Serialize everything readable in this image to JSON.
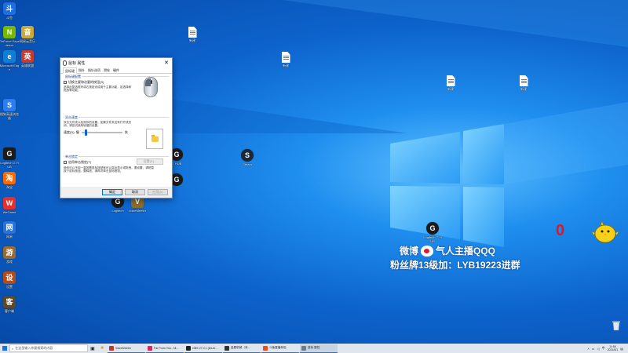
{
  "desktop": {
    "icons_left": [
      {
        "name": "doudian",
        "label": "斗鱼",
        "color": "#1f6fe0",
        "glyph": "斗"
      },
      {
        "name": "nvidia",
        "label": "GeForce Experience",
        "color": "#76b900",
        "glyph": "N"
      },
      {
        "name": "edge",
        "label": "Microsoft Edge",
        "color": "#0f7fd6",
        "glyph": "e"
      },
      {
        "name": "sogou",
        "label": "搜狗高速浏览器",
        "color": "#2d7cf0",
        "glyph": "S"
      },
      {
        "name": "logitech",
        "label": "Logitech G HUB",
        "color": "#1b1b1b",
        "glyph": "G"
      },
      {
        "name": "taobao",
        "label": "淘宝",
        "color": "#ff6a00",
        "glyph": "淘"
      },
      {
        "name": "wegame",
        "label": "WeGame",
        "color": "#e62f2f",
        "glyph": "W"
      },
      {
        "name": "netbar",
        "label": "网易",
        "color": "#2b73d6",
        "glyph": "网"
      },
      {
        "name": "game1",
        "label": "游戏",
        "color": "#9a6b2f",
        "glyph": "游"
      },
      {
        "name": "game2",
        "label": "设置",
        "color": "#b24d1a",
        "glyph": "设"
      },
      {
        "name": "game3",
        "label": "客户端",
        "color": "#5a4a2a",
        "glyph": "客"
      }
    ],
    "icons_col2": [
      {
        "name": "app-a",
        "label": "网易云音乐",
        "color": "#c8aa3a",
        "glyph": "音"
      },
      {
        "name": "app-b",
        "label": "英雄联盟",
        "color": "#c93a2e",
        "glyph": "英"
      }
    ],
    "icons_mid": [
      {
        "name": "logitech-mid",
        "label": "Logitech",
        "glyph": "G"
      },
      {
        "name": "app-c",
        "label": "VoiceMeeter",
        "glyph": "V"
      },
      {
        "name": "steam",
        "label": "Steam",
        "glyph": "S"
      },
      {
        "name": "ghub-mid",
        "label": "G HUB",
        "glyph": "G"
      }
    ],
    "files": [
      {
        "name": "file-1",
        "label": "新建"
      },
      {
        "name": "file-2",
        "label": "新建"
      },
      {
        "name": "file-3",
        "label": "新建"
      },
      {
        "name": "file-4",
        "label": "新建"
      }
    ],
    "logitech_right_label": "Logitech G HUB"
  },
  "dialog": {
    "title": "鼠标 属性",
    "close_glyph": "✕",
    "tabs": [
      "鼠标键",
      "指针",
      "指针选项",
      "滑轮",
      "硬件"
    ],
    "group1": {
      "title": "鼠标键配置",
      "checkbox": "切换主要和次要的按钮(S)",
      "desc": "选择此复选框来将右按钮设成用于主要功能，如选择和拖放等功能。"
    },
    "group2": {
      "title": "双击速度",
      "desc": "双击文件夹以检测你的设置。如果文件夹没有打开或关闭，请尝试使用较慢的设置。",
      "slow": "速度(D): 慢",
      "fast": "快"
    },
    "group3": {
      "title": "单击锁定",
      "checkbox": "启用单击锁定(T)",
      "settings": "设置(E)...",
      "desc": "使你可以不用一直按着鼠标按钮就可以突出显示或拖曳。要设置，请短暂按下鼠标按钮。要释放，请再次单击鼠标按钮。"
    },
    "buttons": {
      "ok": "确定",
      "cancel": "取消",
      "apply": "应用(A)"
    },
    "double_click_speed": 0.08
  },
  "overlay": {
    "weibo_label": "微博",
    "weibo_name": "气人主播QQQ",
    "fans_line": "粉丝牌13级加：LYB19223进群",
    "counter": "0"
  },
  "taskbar": {
    "search_placeholder": "在这里输入你要搜索的内容",
    "apps": [
      {
        "label": "VoiceMeeter",
        "color": "#c0392b"
      },
      {
        "label": "Far From You - Ni...",
        "color": "#e0245e"
      },
      {
        "label": "OBS 27.0.1 (64-bi...",
        "color": "#222222"
      },
      {
        "label": "金属机械（未...",
        "color": "#333333"
      },
      {
        "label": "斗鱼直播伴侣",
        "color": "#e84f1c"
      },
      {
        "label": "鼠标 属性",
        "color": "#6c7a89"
      }
    ],
    "tray_lang": "中",
    "time": "11:56",
    "date": "2021/6/1"
  },
  "colors": {
    "accent": "#0a64d6",
    "counter": "#e8141a",
    "weibo_red": "#e6162d"
  }
}
